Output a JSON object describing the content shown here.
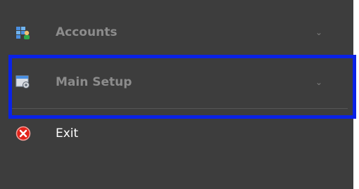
{
  "menu": {
    "items": [
      {
        "label": "Accounts",
        "icon": "accounts-grid-user-icon"
      },
      {
        "label": "Main Setup",
        "icon": "settings-window-icon"
      },
      {
        "label": "Exit",
        "icon": "exit-red-x-icon"
      }
    ]
  },
  "colors": {
    "panel": "#3d3d3d",
    "label_dim": "#8c8c8c",
    "label_bright": "#ffffff",
    "highlight": "#0a22e6"
  }
}
